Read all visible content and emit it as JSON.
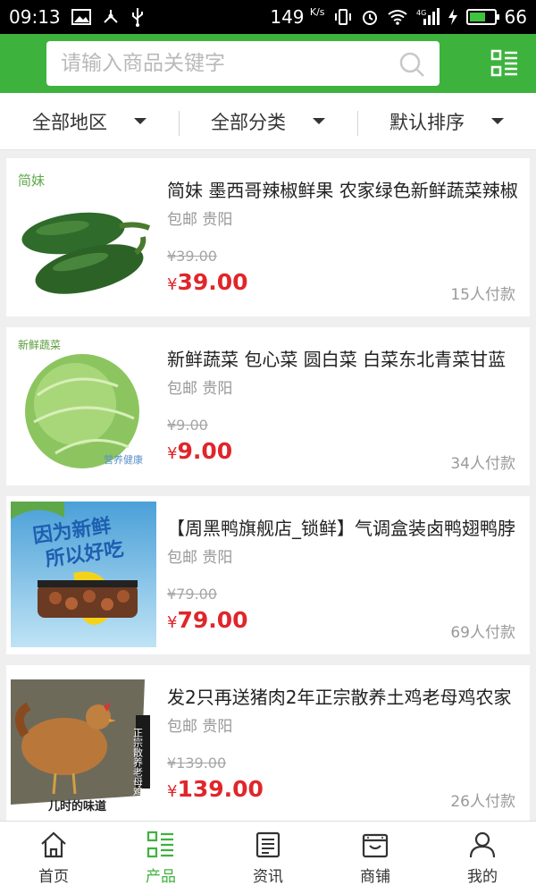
{
  "status_bar": {
    "time": "09:13",
    "net_speed": "149",
    "net_unit": "K/s",
    "network": "4G",
    "battery": "66",
    "battery_level": 0.66
  },
  "search": {
    "placeholder": "请输入商品关键字"
  },
  "filters": [
    {
      "label": "全部地区"
    },
    {
      "label": "全部分类"
    },
    {
      "label": "默认排序"
    }
  ],
  "products": [
    {
      "title": "简妹 墨西哥辣椒鲜果 农家绿色新鲜蔬菜辣椒",
      "shipping": "包邮 贵阳",
      "old_price": "¥39.00",
      "price": "39.00",
      "sold": "15人付款",
      "image_label": "简妹"
    },
    {
      "title": "新鲜蔬菜 包心菜 圆白菜 白菜东北青菜甘蓝",
      "shipping": "包邮 贵阳",
      "old_price": "¥9.00",
      "price": "9.00",
      "sold": "34人付款",
      "image_label": "新鲜蔬菜",
      "image_label2": "营养健康"
    },
    {
      "title": "【周黑鸭旗舰店_锁鲜】气调盒装卤鸭翅鸭脖",
      "shipping": "包邮 贵阳",
      "old_price": "¥79.00",
      "price": "79.00",
      "sold": "69人付款",
      "image_label": "因为新鲜",
      "image_label2": "所以好吃"
    },
    {
      "title": "发2只再送猪肉2年正宗散养土鸡老母鸡农家",
      "shipping": "包邮 贵阳",
      "old_price": "¥139.00",
      "price": "139.00",
      "sold": "26人付款",
      "image_label": "正宗散养老母鸡",
      "image_label2": "儿时的味道"
    }
  ],
  "currency": "¥",
  "tabs": [
    {
      "label": "首页",
      "icon": "home-icon"
    },
    {
      "label": "产品",
      "icon": "list-icon",
      "active": true
    },
    {
      "label": "资讯",
      "icon": "news-icon"
    },
    {
      "label": "商铺",
      "icon": "shop-icon"
    },
    {
      "label": "我的",
      "icon": "user-icon"
    }
  ],
  "colors": {
    "brand": "#3db33d",
    "price": "#e0262b"
  }
}
